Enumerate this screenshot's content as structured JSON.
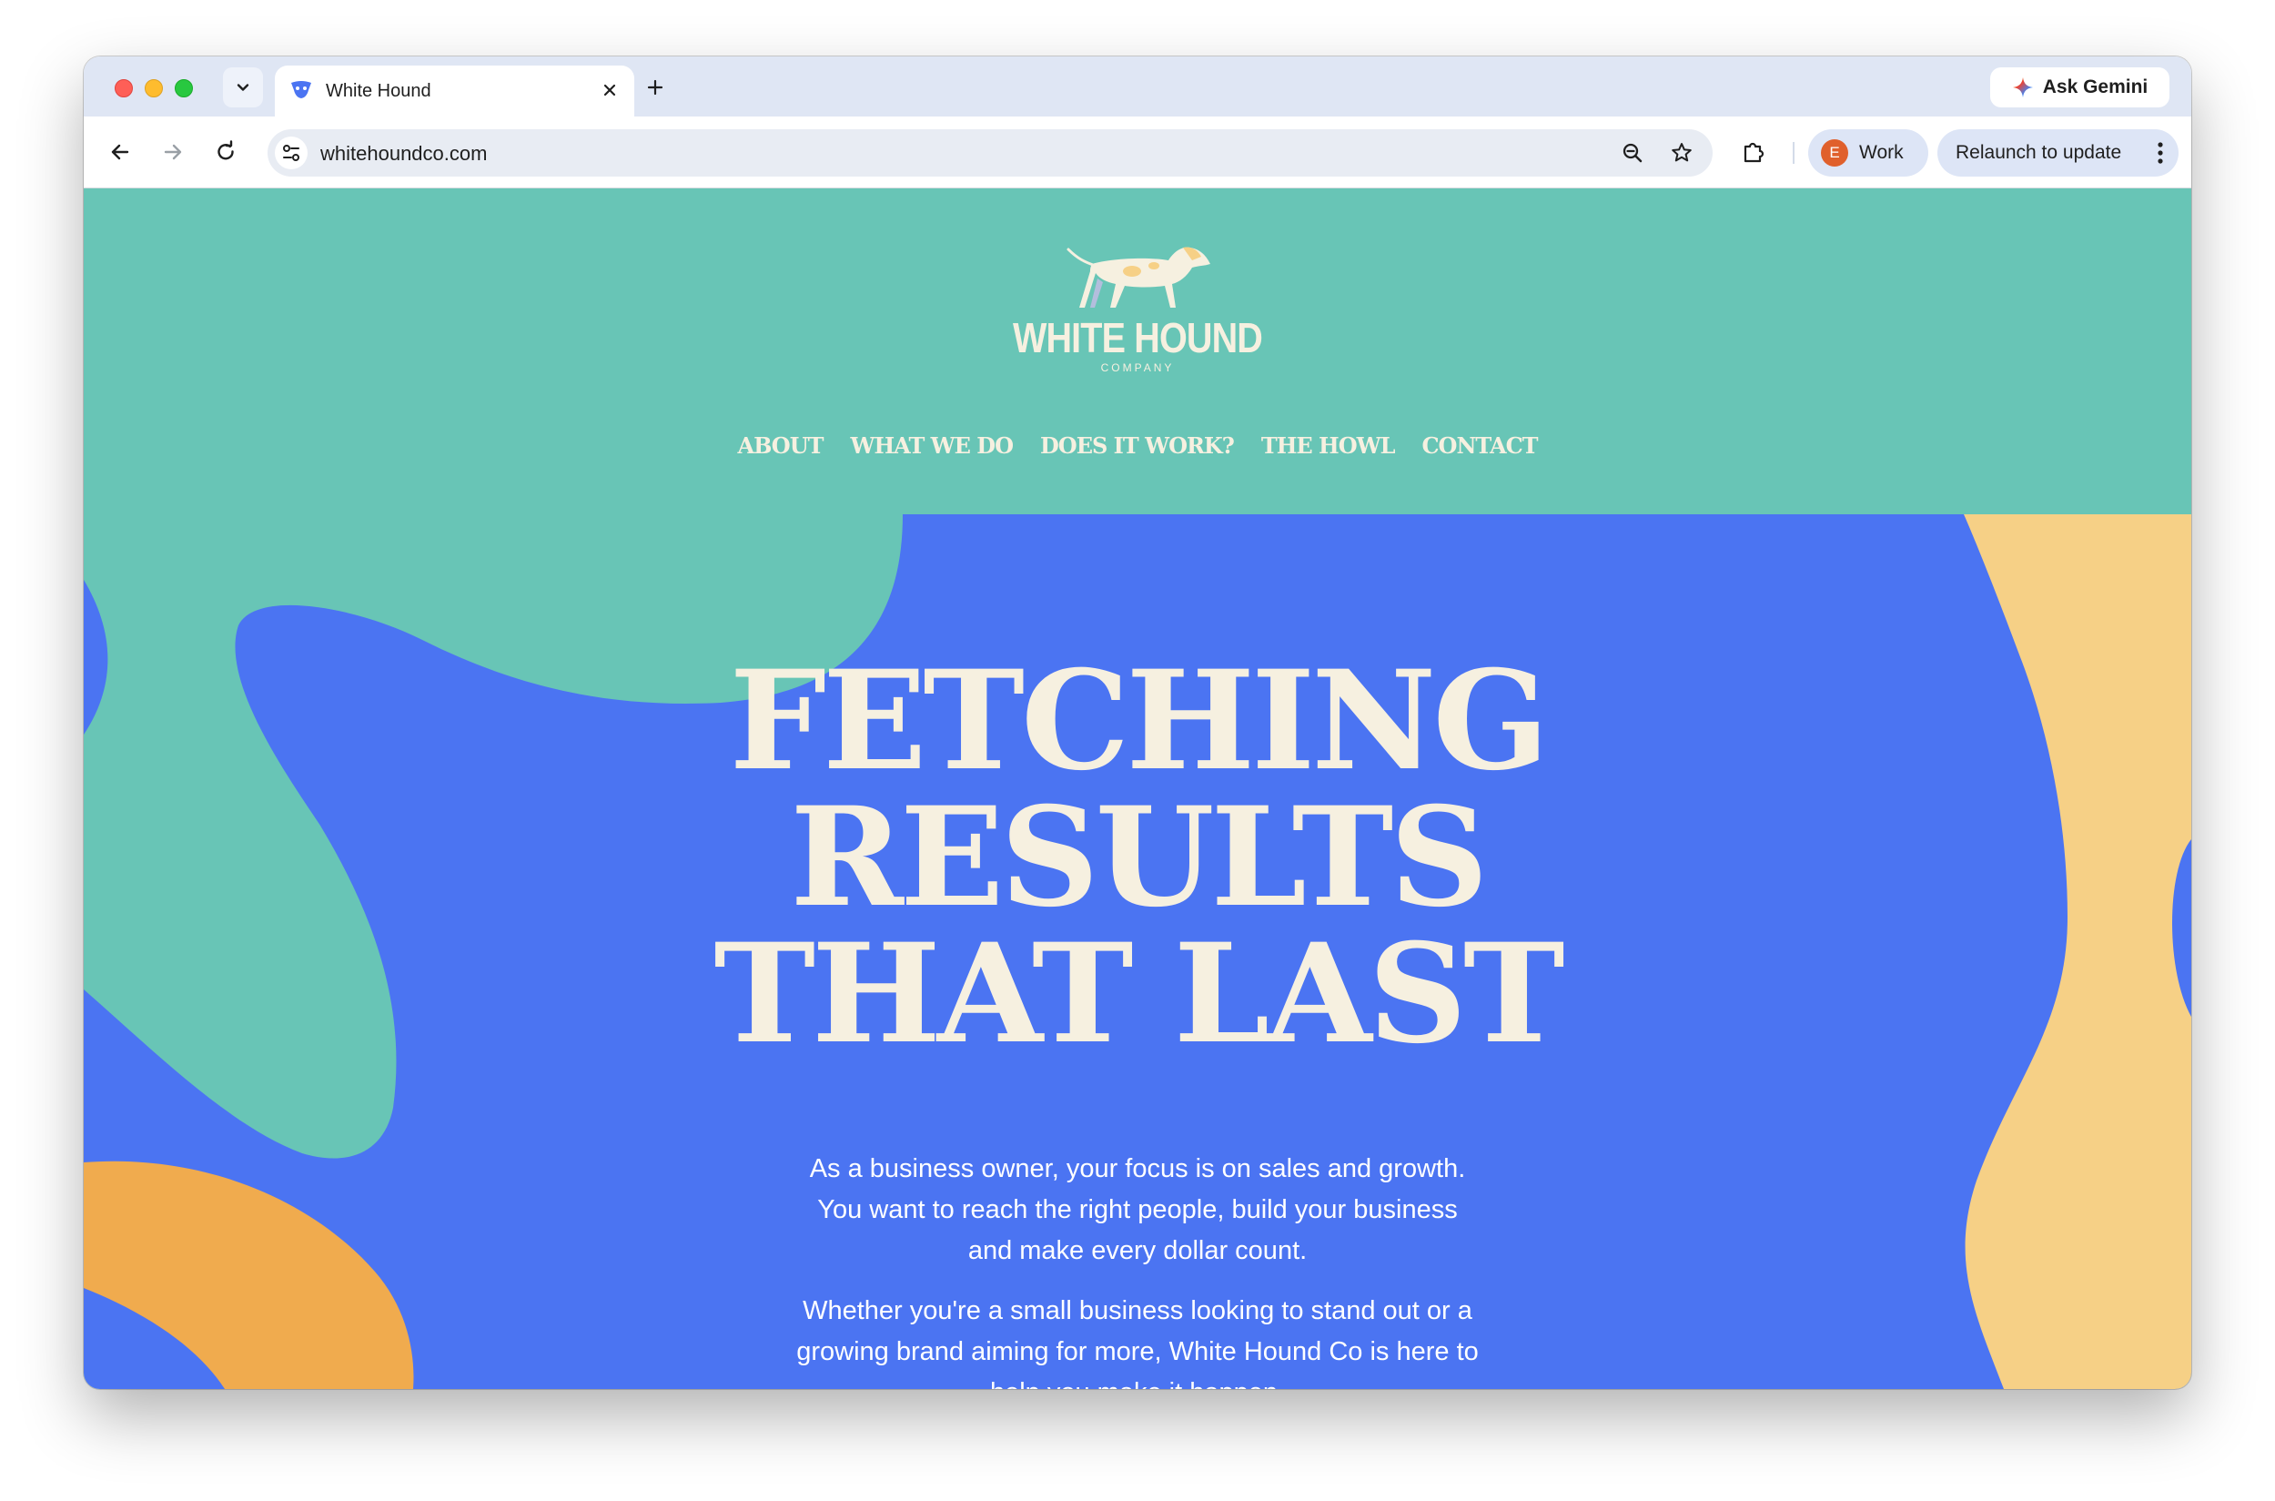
{
  "browser": {
    "tab": {
      "title": "White Hound"
    },
    "ask_gemini_label": "Ask Gemini",
    "url": "whitehoundco.com",
    "profile": {
      "initial": "E",
      "label": "Work"
    },
    "relaunch_label": "Relaunch to update"
  },
  "site": {
    "logo": {
      "name": "WHITE HOUND",
      "subtitle": "COMPANY"
    },
    "nav": [
      "ABOUT",
      "WHAT WE DO",
      "DOES IT WORK?",
      "THE HOWL",
      "CONTACT"
    ],
    "hero": {
      "title_lines": [
        "FETCHING",
        "RESULTS",
        "THAT LAST"
      ],
      "paragraph_1": [
        "As a business owner, your focus is on sales and growth.",
        "You want to reach the right people, build your business",
        "and make every dollar count."
      ],
      "paragraph_2": [
        "Whether you're a small business looking to stand out or a",
        "growing brand aiming for more, White Hound Co is here to",
        "help you make it happen."
      ]
    }
  },
  "colors": {
    "teal": "#68c5b6",
    "blue": "#4b74f2",
    "orange": "#f0ab4e",
    "sand": "#f6d086",
    "cream": "#f6f0e0"
  }
}
